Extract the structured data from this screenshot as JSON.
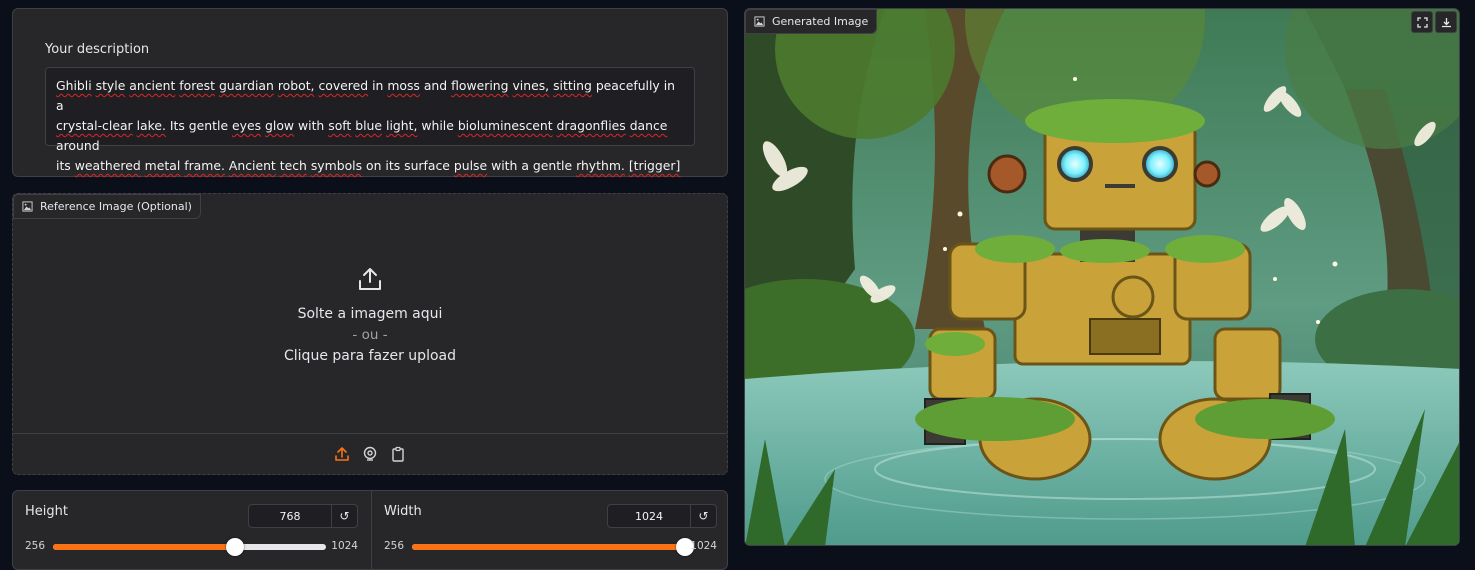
{
  "description": {
    "label": "Your description",
    "text_lines": [
      "Ghibli style ancient forest guardian robot, covered in moss and flowering vines, sitting peacefully in a",
      "crystal-clear lake. Its gentle eyes glow with soft blue light, while bioluminescent dragonflies dance around",
      "its weathered metal frame. Ancient tech symbols on its surface pulse with a gentle rhythm. [trigger]"
    ]
  },
  "reference": {
    "label": "Reference Image (Optional)",
    "drop_text": "Solte a imagem aqui",
    "or_text": "- ou -",
    "click_text": "Clique para fazer upload",
    "tools": [
      "upload-icon",
      "webcam-icon",
      "clipboard-icon"
    ]
  },
  "height": {
    "label": "Height",
    "value": "768",
    "min": "256",
    "max": "1024",
    "reset": "↺",
    "fraction": 0.667
  },
  "width": {
    "label": "Width",
    "value": "1024",
    "min": "256",
    "max": "1024",
    "reset": "↺",
    "fraction": 1.0
  },
  "generated": {
    "label": "Generated Image",
    "actions": [
      "fullscreen-icon",
      "download-icon"
    ],
    "colors": {
      "sky": "#5f9c83",
      "tree": "#3d5a2b",
      "robot": "#c9a33a",
      "water": "#6fb3a4",
      "leaf": "#6fae3a",
      "eye": "#7ff0ff"
    }
  }
}
